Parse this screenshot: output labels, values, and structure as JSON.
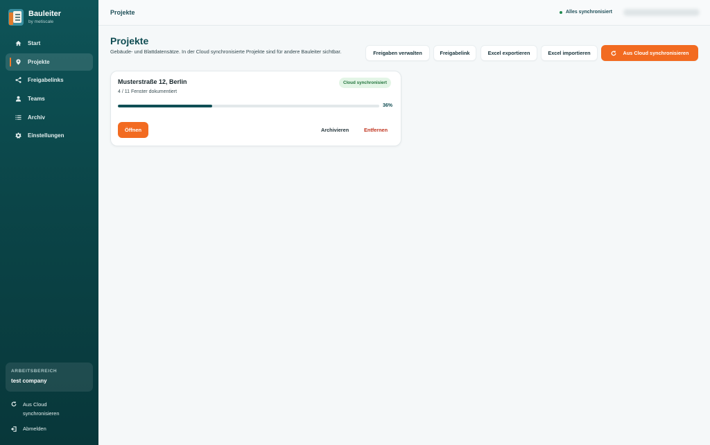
{
  "app": {
    "name": "Bauleiter",
    "subtitle": "by metiscale"
  },
  "sidebar": {
    "items": [
      {
        "label": "Start",
        "icon": "home-icon"
      },
      {
        "label": "Projekte",
        "icon": "location-pin-icon",
        "active": true
      },
      {
        "label": "Freigabelinks",
        "icon": "share-icon"
      },
      {
        "label": "Teams",
        "icon": "user-icon"
      },
      {
        "label": "Archiv",
        "icon": "list-icon"
      },
      {
        "label": "Einstellungen",
        "icon": "gear-icon"
      }
    ],
    "workspace": {
      "label": "ARBEITSBEREICH",
      "name": "test company"
    },
    "sync_label": "Aus Cloud synchronisieren",
    "logout_label": "Abmelden"
  },
  "topbar": {
    "breadcrumb": "Projekte",
    "sync_status": "Alles synchronisiert",
    "sync_status_color": "#1f8a4f"
  },
  "main": {
    "title": "Projekte",
    "description": "Gebäude- und Blattdatensätze. In der Cloud synchronisierte Projekte sind für andere Bauleiter sichtbar.",
    "buttons": {
      "manage_shares": "Freigaben verwalten",
      "share_link": "Freigabelink",
      "excel_export": "Excel exportieren",
      "excel_import": "Excel importieren",
      "cloud_sync": "Aus Cloud synchronisieren"
    },
    "project": {
      "title": "Musterstraße 12, Berlin",
      "subtitle": "4 / 11 Fenster dokumentiert",
      "badge": "Cloud synchronisiert",
      "progress": 0.36,
      "progress_label": "36%",
      "open_label": "Öffnen",
      "archive_label": "Archivieren",
      "remove_label": "Entfernen"
    }
  },
  "colors": {
    "accent": "#f26b21",
    "sidebar": "#0b4548",
    "primary_text": "#0f4c52",
    "danger": "#c0341f"
  }
}
